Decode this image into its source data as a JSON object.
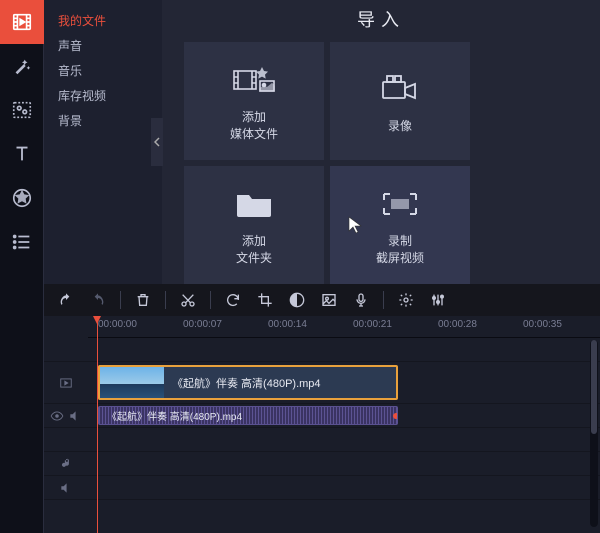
{
  "rail": [
    "media",
    "wand",
    "filters",
    "text",
    "stickers",
    "list"
  ],
  "sources": {
    "items": [
      "我的文件",
      "声音",
      "音乐",
      "库存视频",
      "背景"
    ],
    "active": 0
  },
  "import": {
    "title": "导入",
    "tiles": [
      {
        "line1": "添加",
        "line2": "媒体文件"
      },
      {
        "line1": "录像",
        "line2": ""
      },
      {
        "line1": "添加",
        "line2": "文件夹"
      },
      {
        "line1": "录制",
        "line2": "截屏视频"
      }
    ]
  },
  "ruler": [
    "00:00:00",
    "00:00:07",
    "00:00:14",
    "00:00:21",
    "00:00:28",
    "00:00:35"
  ],
  "clips": {
    "video_name": "《起航》伴奏 高清(480P).mp4",
    "audio_name": "《起航》伴奏 高清(480P).mp4"
  }
}
